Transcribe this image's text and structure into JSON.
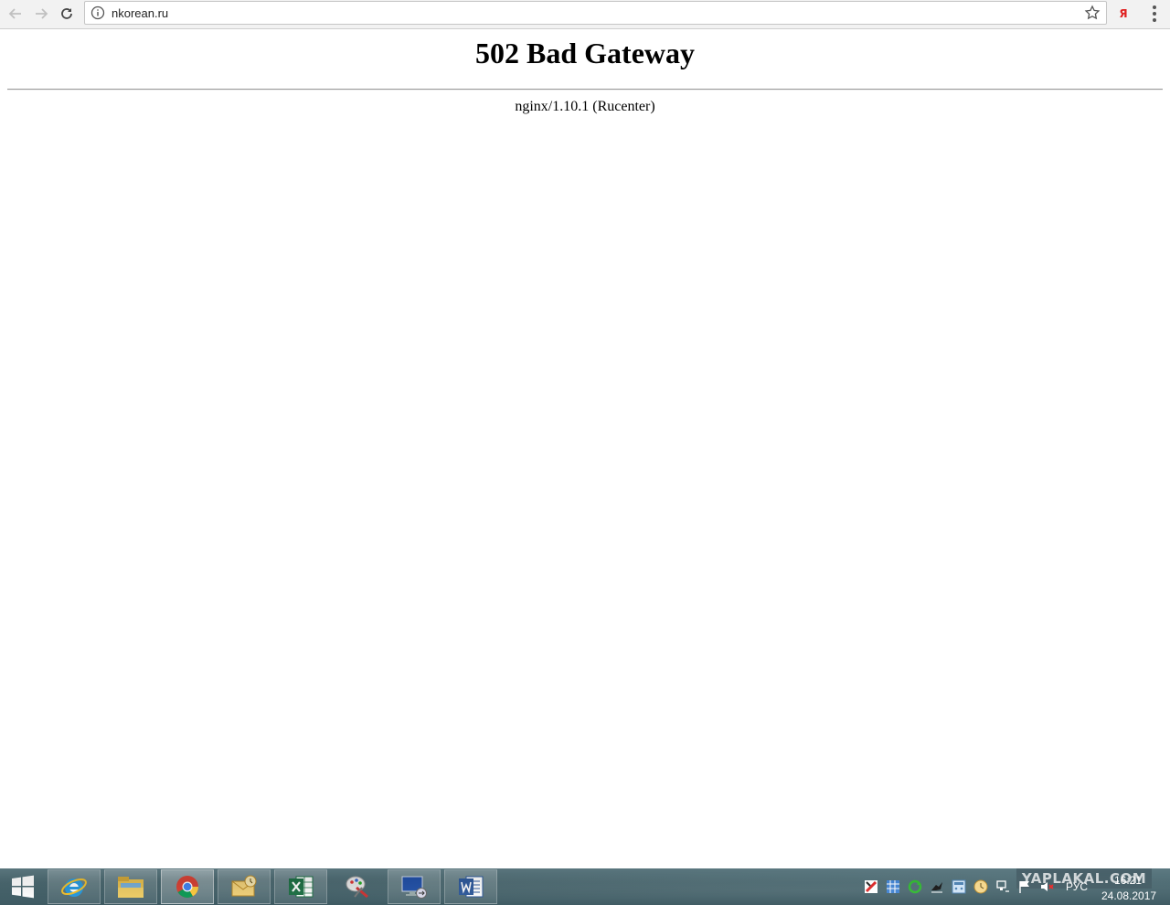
{
  "browser": {
    "url": "nkorean.ru",
    "yandex_extension_label": "Я"
  },
  "page": {
    "heading": "502 Bad Gateway",
    "server_signature": "nginx/1.10.1 (Rucenter)"
  },
  "taskbar": {
    "apps": [
      {
        "name": "internet-explorer",
        "icon": "ie-icon",
        "active": false
      },
      {
        "name": "file-explorer",
        "icon": "folder-icon",
        "active": false
      },
      {
        "name": "chrome",
        "icon": "chrome-icon",
        "active": true
      },
      {
        "name": "outlook-mail",
        "icon": "mail-envelope-icon",
        "active": false
      },
      {
        "name": "excel",
        "icon": "excel-icon",
        "active": false
      },
      {
        "name": "paint-tool",
        "icon": "paint-icon",
        "active": false
      },
      {
        "name": "remote-desktop",
        "icon": "remote-desktop-icon",
        "active": false
      },
      {
        "name": "word",
        "icon": "word-icon",
        "active": false
      }
    ],
    "language": "РУС",
    "clock_time": "16:21",
    "clock_date": "24.08.2017",
    "watermark": "YAPLAKAL.COM"
  }
}
